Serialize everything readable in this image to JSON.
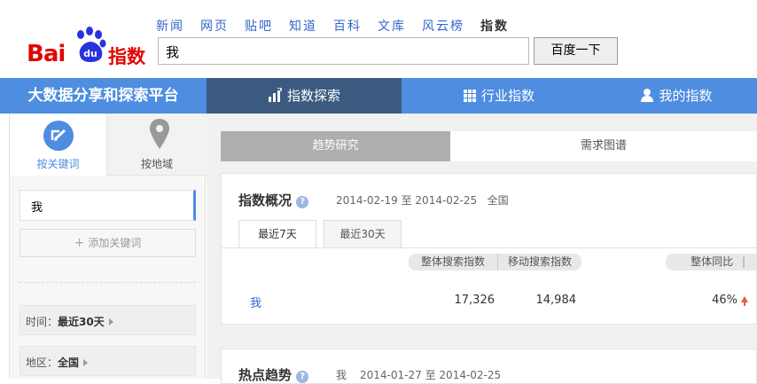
{
  "header": {
    "logo_text_bai": "Bai",
    "logo_text_du": "du",
    "logo_text_zhishu": "指数",
    "topnav": [
      {
        "label": "新闻",
        "active": false
      },
      {
        "label": "网页",
        "active": false
      },
      {
        "label": "贴吧",
        "active": false
      },
      {
        "label": "知道",
        "active": false
      },
      {
        "label": "百科",
        "active": false
      },
      {
        "label": "文库",
        "active": false
      },
      {
        "label": "风云榜",
        "active": false
      },
      {
        "label": "指数",
        "active": true
      }
    ],
    "search_value": "我",
    "search_button": "百度一下"
  },
  "navbar": {
    "platform": "大数据分享和探索平台",
    "tabs": [
      {
        "label": "指数探索",
        "icon": "bar-chart-icon",
        "active": true
      },
      {
        "label": "行业指数",
        "icon": "grid-icon",
        "active": false
      },
      {
        "label": "我的指数",
        "icon": "user-icon",
        "active": false
      }
    ]
  },
  "sidebar": {
    "tab_keyword": "按关键词",
    "tab_area": "按地域",
    "keyword": "我",
    "add_keyword": "添加关键词",
    "add_symbol": "+",
    "time_label": "时间：",
    "time_value": "最近30天",
    "area_label": "地区：",
    "area_value": "全国"
  },
  "main": {
    "subtabs": [
      "趋势研究",
      "需求图谱"
    ],
    "overview": {
      "title": "指数概况",
      "help": "?",
      "date_start": "2014-02-19",
      "date_sep": "至",
      "date_end": "2014-02-25",
      "region": "全国",
      "tabs": [
        "最近7天",
        "最近30天"
      ],
      "columns": [
        "整体搜索指数",
        "移动搜索指数",
        "整体同比"
      ],
      "rows": [
        {
          "keyword": "我",
          "overall": "17,326",
          "mobile": "14,984",
          "yoy": "46%"
        }
      ]
    },
    "hot": {
      "title": "热点趋势",
      "help": "?",
      "keyword": "我",
      "date_start": "2014-01-27",
      "date_sep": "至",
      "date_end": "2014-02-25"
    }
  },
  "colors": {
    "brand_red": "#e10602",
    "nav_blue": "#4e8de0",
    "nav_active": "#3c5a80",
    "link_blue": "#3366cc",
    "up_arrow": "#e85a3a"
  }
}
